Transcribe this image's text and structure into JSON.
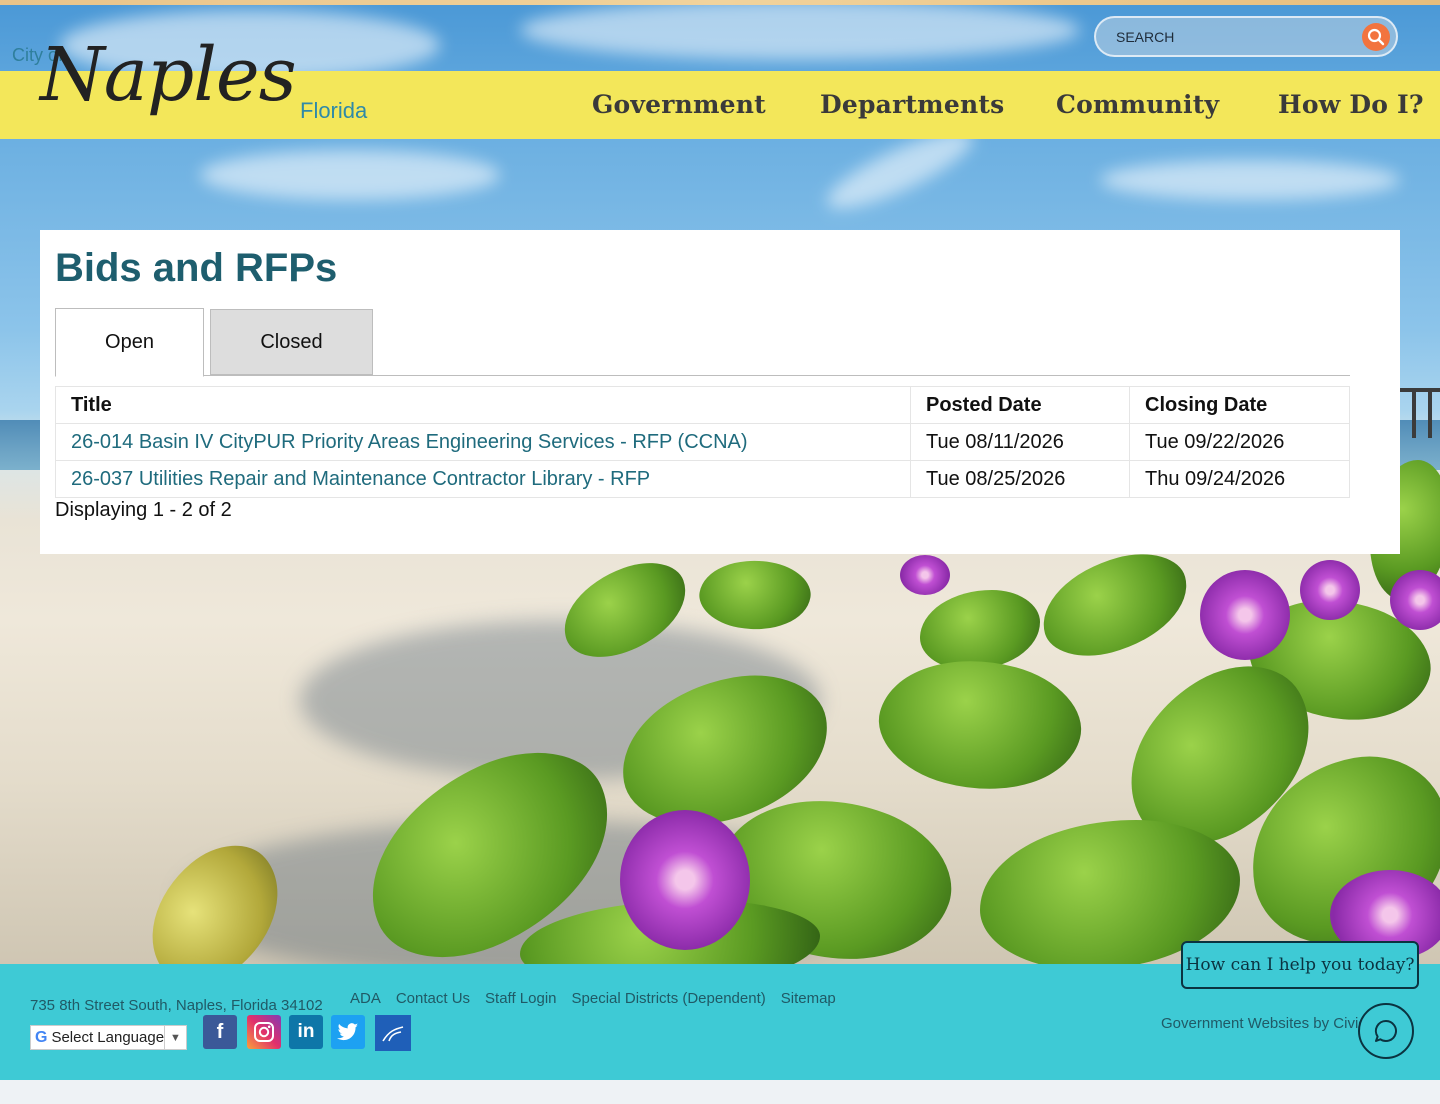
{
  "header": {
    "logo": {
      "city_of": "City of",
      "name": "Naples",
      "state": "Florida"
    },
    "search": {
      "placeholder": "SEARCH",
      "icon": "search-icon"
    },
    "nav": [
      "Government",
      "Departments",
      "Community",
      "How Do I?"
    ]
  },
  "main": {
    "title": "Bids and RFPs",
    "tabs": [
      {
        "label": "Open",
        "active": true
      },
      {
        "label": "Closed",
        "active": false
      }
    ],
    "table": {
      "headers": [
        "Title",
        "Posted Date",
        "Closing Date"
      ],
      "rows": [
        {
          "title": "26-014 Basin IV CityPUR Priority Areas Engineering Services - RFP (CCNA)",
          "posted": "Tue 08/11/2026",
          "closing": "Tue 09/22/2026"
        },
        {
          "title": "26-037 Utilities Repair and Maintenance Contractor Library - RFP",
          "posted": "Tue 08/25/2026",
          "closing": "Thu 09/24/2026"
        }
      ]
    },
    "display_count": "Displaying 1 - 2 of 2"
  },
  "footer": {
    "address": "735 8th Street South, Naples, Florida 34102",
    "links": [
      "ADA",
      "Contact Us",
      "Staff Login",
      "Special Districts (Dependent)",
      "Sitemap"
    ],
    "language": "Select Language",
    "social": [
      "facebook-icon",
      "instagram-icon",
      "linkedin-icon",
      "twitter-icon",
      "nextdoor-icon"
    ],
    "credit": "Government Websites by Civic"
  },
  "chat": {
    "prompt": "How can I help you today?",
    "icon": "chat-icon"
  },
  "colors": {
    "nav_yellow": "#f3e75a",
    "title_teal": "#1e5e6e",
    "link_teal": "#1f6b7d",
    "footer_aqua": "#3ecad5",
    "search_orange": "#f2743f"
  }
}
